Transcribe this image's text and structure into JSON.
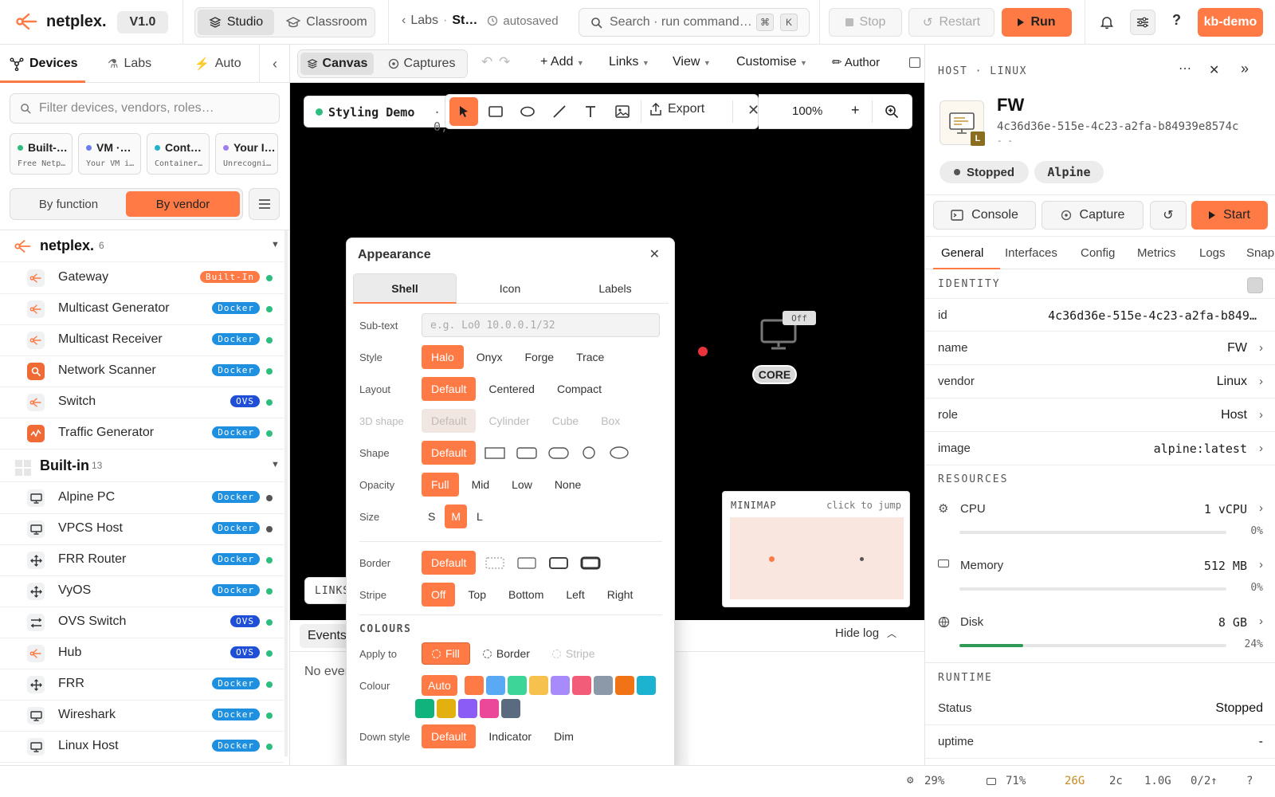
{
  "topbar": {
    "brand": "netplex.",
    "version": "V1.0",
    "mode_tabs": [
      "Studio",
      "Classroom"
    ],
    "breadcrumb_labs": "Labs",
    "breadcrumb_sep": "·",
    "breadcrumb_current": "St…",
    "autosave": "autosaved",
    "search_placeholder": "Search · run command…",
    "kbd_mod": "⌘",
    "kbd_key": "K",
    "stop": "Stop",
    "restart": "Restart",
    "run": "Run",
    "help": "?",
    "user": "kb-demo"
  },
  "left": {
    "tabs": [
      "Devices",
      "Labs",
      "Auto"
    ],
    "filter_placeholder": "Filter devices, vendors, roles…",
    "cards": [
      {
        "title": "Built-…",
        "sub": "Free Netp…",
        "color": "#2dbd7e"
      },
      {
        "title": "VM ·…",
        "sub": "Your VM i…",
        "color": "#6a7cf0"
      },
      {
        "title": "Cont…",
        "sub": "Container…",
        "color": "#21b1c9"
      },
      {
        "title": "Your I…",
        "sub": "Unrecogni…",
        "color": "#a17ef0"
      }
    ],
    "group_toggle": [
      "By function",
      "By vendor"
    ],
    "vendor_group": {
      "name": "netplex.",
      "count": "6"
    },
    "vendor_devices": [
      {
        "name": "Gateway",
        "badge": "Built-In",
        "kind": "built",
        "status": "#2dbd7e"
      },
      {
        "name": "Multicast Generator",
        "badge": "Docker",
        "kind": "docker",
        "status": "#2dbd7e"
      },
      {
        "name": "Multicast Receiver",
        "badge": "Docker",
        "kind": "docker",
        "status": "#2dbd7e"
      },
      {
        "name": "Network Scanner",
        "badge": "Docker",
        "kind": "docker",
        "status": "#2dbd7e"
      },
      {
        "name": "Switch",
        "badge": "OVS",
        "kind": "ovs",
        "status": "#2dbd7e"
      },
      {
        "name": "Traffic Generator",
        "badge": "Docker",
        "kind": "docker",
        "status": "#2dbd7e"
      }
    ],
    "builtin_group": {
      "name": "Built-in",
      "count": "13"
    },
    "builtin_devices": [
      {
        "name": "Alpine PC",
        "badge": "Docker",
        "kind": "docker",
        "status": "#555555"
      },
      {
        "name": "VPCS Host",
        "badge": "Docker",
        "kind": "docker",
        "status": "#555555"
      },
      {
        "name": "FRR Router",
        "badge": "Docker",
        "kind": "docker",
        "status": "#2dbd7e"
      },
      {
        "name": "VyOS",
        "badge": "Docker",
        "kind": "docker",
        "status": "#2dbd7e"
      },
      {
        "name": "OVS Switch",
        "badge": "OVS",
        "kind": "ovs",
        "status": "#2dbd7e"
      },
      {
        "name": "Hub",
        "badge": "OVS",
        "kind": "ovs",
        "status": "#2dbd7e"
      },
      {
        "name": "FRR",
        "badge": "Docker",
        "kind": "docker",
        "status": "#2dbd7e"
      },
      {
        "name": "Wireshark",
        "badge": "Docker",
        "kind": "docker",
        "status": "#2dbd7e"
      },
      {
        "name": "Linux Host",
        "badge": "Docker",
        "kind": "docker",
        "status": "#2dbd7e"
      }
    ]
  },
  "center": {
    "view_tabs": [
      "Canvas",
      "Captures"
    ],
    "menu": [
      "+ Add",
      "Links",
      "View",
      "Customise"
    ],
    "author": "Author",
    "lab_name": "Styling Demo",
    "lab_meta": "· 0,",
    "export": "Export",
    "zoom": "100%",
    "zoom_minus": "−",
    "zoom_plus": "+",
    "node_label": "CORE",
    "node_state": "Off",
    "minimap_title": "MINIMAP",
    "minimap_hint": "click to jump",
    "links_label": "LINKS",
    "events_tab": "Events",
    "hide_log": "Hide log",
    "no_events": "No even"
  },
  "appearance": {
    "title": "Appearance",
    "tabs": [
      "Shell",
      "Icon",
      "Labels"
    ],
    "subtext_label": "Sub-text",
    "subtext_placeholder": "e.g. Lo0 10.0.0.1/32",
    "style_label": "Style",
    "style_opts": [
      "Halo",
      "Onyx",
      "Forge",
      "Trace"
    ],
    "layout_label": "Layout",
    "layout_opts": [
      "Default",
      "Centered",
      "Compact"
    ],
    "shape3d_label": "3D shape",
    "shape3d_opts": [
      "Default",
      "Cylinder",
      "Cube",
      "Box"
    ],
    "shape_label": "Shape",
    "shape_default": "Default",
    "opacity_label": "Opacity",
    "opacity_opts": [
      "Full",
      "Mid",
      "Low",
      "None"
    ],
    "size_label": "Size",
    "size_opts": [
      "S",
      "M",
      "L"
    ],
    "border_label": "Border",
    "border_default": "Default",
    "stripe_label": "Stripe",
    "stripe_opts": [
      "Off",
      "Top",
      "Bottom",
      "Left",
      "Right"
    ],
    "colours_heading": "COLOURS",
    "apply_label": "Apply to",
    "apply_opts": [
      "Fill",
      "Border",
      "Stripe"
    ],
    "colour_label": "Colour",
    "colour_auto": "Auto",
    "palette": [
      "#ff7a45",
      "#5aa9f5",
      "#3ed598",
      "#f7c14d",
      "#a78bfa",
      "#f25c78",
      "#8c99a8",
      "#f07316",
      "#1bb3d0",
      "#10b37b",
      "#e2b10f",
      "#8b5cf6",
      "#ec4899",
      "#5b6b7f"
    ],
    "down_label": "Down style",
    "down_opts": [
      "Default",
      "Indicator",
      "Dim"
    ]
  },
  "right": {
    "kind": "HOST · LINUX",
    "name": "FW",
    "id_full": "4c36d36e-515e-4c23-a2fa-b84939e8574c",
    "id_dash": "- -",
    "vendor_tag": "L",
    "status_chip": "Stopped",
    "image_chip": "Alpine",
    "console": "Console",
    "capture": "Capture",
    "start": "Start",
    "tabs": [
      "General",
      "Interfaces",
      "Config",
      "Metrics",
      "Logs",
      "Snap"
    ],
    "identity": "IDENTITY",
    "props": [
      {
        "k": "id",
        "v": "4c36d36e-515e-4c23-a2fa-b849…",
        "mono": true
      },
      {
        "k": "name",
        "v": "FW"
      },
      {
        "k": "vendor",
        "v": "Linux"
      },
      {
        "k": "role",
        "v": "Host"
      },
      {
        "k": "image",
        "v": "alpine:latest",
        "mono": true
      }
    ],
    "resources": "RESOURCES",
    "cpu": {
      "label": "CPU",
      "value": "1 vCPU",
      "pct": "0%",
      "fill": 0
    },
    "memory": {
      "label": "Memory",
      "value": "512 MB",
      "pct": "0%",
      "fill": 0
    },
    "disk": {
      "label": "Disk",
      "value": "8 GB",
      "pct": "24%",
      "fill": 0.24
    },
    "runtime": "RUNTIME",
    "status_label": "Status",
    "status_value": "Stopped",
    "uptime_label": "uptime",
    "uptime_value": "-"
  },
  "status": {
    "cpu": "29%",
    "mem": "71%",
    "disk": "26G",
    "cores": "2c",
    "net": "1.0G",
    "links": "0/2↑",
    "help": "?"
  }
}
